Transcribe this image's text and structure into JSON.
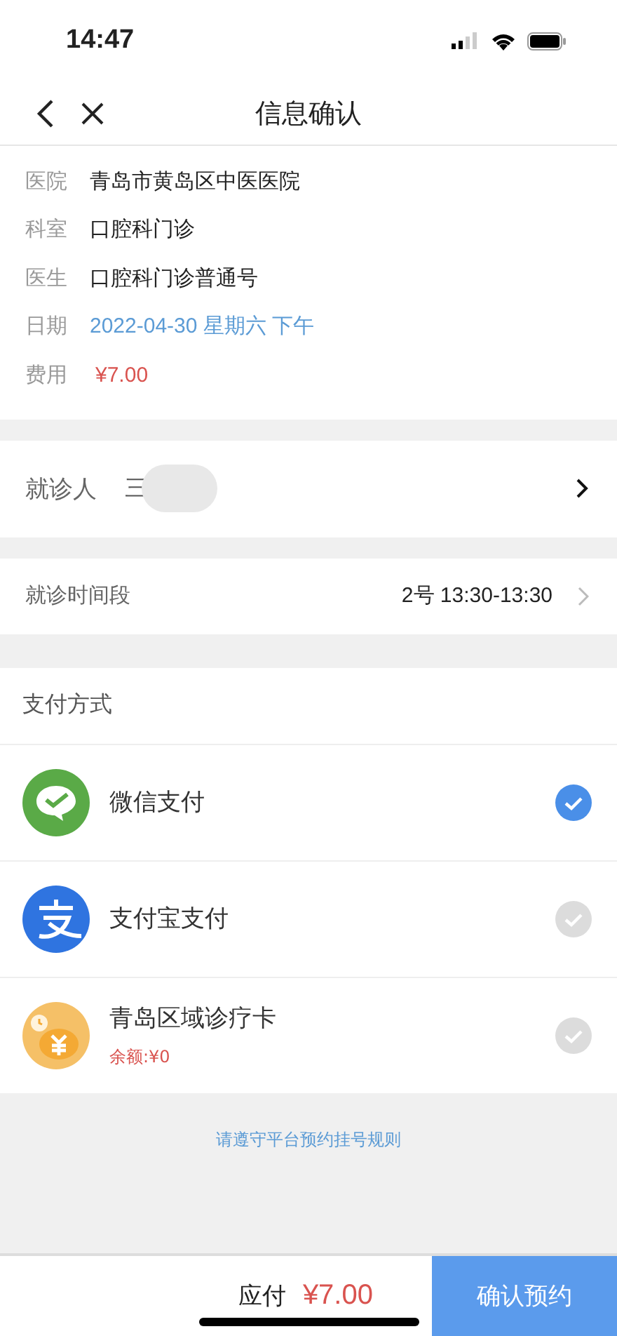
{
  "status_bar": {
    "time": "14:47"
  },
  "nav": {
    "title": "信息确认"
  },
  "info": [
    {
      "label": "医院",
      "value": "青岛市黄岛区中医医院",
      "kind": "plain"
    },
    {
      "label": "科室",
      "value": "口腔科门诊",
      "kind": "plain"
    },
    {
      "label": "医生",
      "value": "口腔科门诊普通号",
      "kind": "plain"
    },
    {
      "label": "日期",
      "value": "2022-04-30 星期六 下午",
      "kind": "date"
    },
    {
      "label": "费用",
      "value": "¥7.00",
      "kind": "price"
    }
  ],
  "patient": {
    "label": "就诊人",
    "name": "三"
  },
  "time_slot": {
    "label": "就诊时间段",
    "value": "2号 13:30-13:30"
  },
  "payment": {
    "title": "支付方式",
    "methods": [
      {
        "kind": "wechat",
        "name": "微信支付",
        "selected": true
      },
      {
        "kind": "alipay",
        "name": "支付宝支付",
        "selected": false
      },
      {
        "kind": "card",
        "name": "青岛区域诊疗卡",
        "balance": "余额:¥0",
        "selected": false
      }
    ]
  },
  "rules_link": "请遵守平台预约挂号规则",
  "footer": {
    "label": "应付",
    "amount": "¥7.00",
    "button": "确认预约"
  }
}
